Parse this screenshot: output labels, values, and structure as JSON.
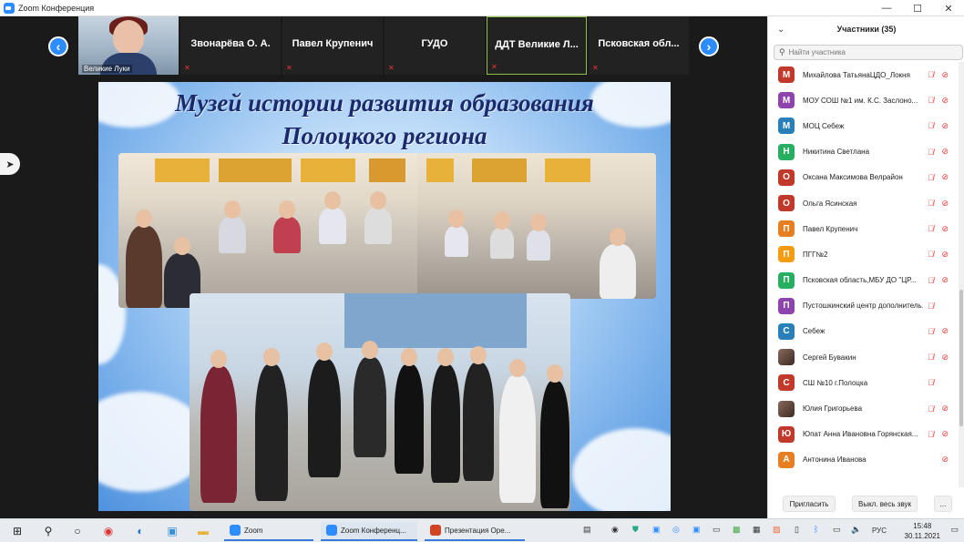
{
  "window": {
    "title": "Zoom Конференция",
    "controls": [
      "—",
      "☐",
      "✕"
    ]
  },
  "strip": {
    "tiles": [
      {
        "name": "Великие Луки",
        "type": "video"
      },
      {
        "name": "Звонарёва О. А."
      },
      {
        "name": "Павел Крупенич"
      },
      {
        "name": "ГУДО"
      },
      {
        "name": "ДДТ Великие Л...",
        "active": true
      },
      {
        "name": "Псковская обл..."
      }
    ]
  },
  "slide": {
    "title_line1": "Музей истории развития образования",
    "title_line2": "Полоцкого региона"
  },
  "panel": {
    "title": "Участники (35)",
    "search_placeholder": "Найти участника",
    "participants": [
      {
        "initial": "М",
        "name": "Михайлова ТатьянаЦДО_Локня",
        "color": "#C0392B",
        "mic_muted": true,
        "video_off": true
      },
      {
        "initial": "М",
        "name": "МОУ СОШ №1 им. К.С. Заслоно...",
        "color": "#8E44AD",
        "mic_muted": true,
        "video_off": true
      },
      {
        "initial": "М",
        "name": "МОЦ Себеж",
        "color": "#2980B9",
        "mic_muted": true,
        "video_off": true
      },
      {
        "initial": "Н",
        "name": "Никитина Светлана",
        "color": "#27AE60",
        "mic_muted": true,
        "video_off": true
      },
      {
        "initial": "О",
        "name": "Оксана Максимова Велрайон",
        "color": "#C0392B",
        "mic_muted": true,
        "video_off": true
      },
      {
        "initial": "О",
        "name": "Ольга Ясинская",
        "color": "#C0392B",
        "mic_muted": true,
        "video_off": true
      },
      {
        "initial": "П",
        "name": "Павел Крупенич",
        "color": "#E67E22",
        "mic_muted": true,
        "video_off": true
      },
      {
        "initial": "П",
        "name": "ПГГ№2",
        "color": "#F39C12",
        "mic_muted": true,
        "video_off": true
      },
      {
        "initial": "П",
        "name": "Псковская область,МБУ ДО \"ЦР...",
        "color": "#27AE60",
        "mic_muted": true,
        "video_off": true
      },
      {
        "initial": "П",
        "name": "Пустошкинский центр дополнитель...",
        "color": "#8E44AD",
        "mic_muted": true,
        "video_off": false
      },
      {
        "initial": "С",
        "name": "Себеж",
        "color": "#2980B9",
        "mic_muted": true,
        "video_off": true
      },
      {
        "initial": "",
        "name": "Сергей Бувакин",
        "color": "#5a4a40",
        "photo": true,
        "mic_muted": true,
        "video_off": true
      },
      {
        "initial": "С",
        "name": "СШ №10 г.Полоцка",
        "color": "#C0392B",
        "mic_muted": true,
        "video_off": false
      },
      {
        "initial": "",
        "name": "Юлия Григорьева",
        "color": "#5a4a40",
        "photo": true,
        "mic_muted": true,
        "video_off": true
      },
      {
        "initial": "Ю",
        "name": "Юпат Анна Ивановна Горянская...",
        "color": "#C0392B",
        "mic_muted": true,
        "video_off": true
      },
      {
        "initial": "А",
        "name": "Антонина Иванова",
        "color": "#E67E22",
        "mic_muted": false,
        "video_off": true
      }
    ],
    "footer": {
      "invite": "Пригласить",
      "mute_all": "Выкл. весь звук",
      "more": "..."
    }
  },
  "taskbar": {
    "apps": [
      {
        "label": "Zoom",
        "color": "#2D8CFF"
      },
      {
        "label": "Zoom Конференц...",
        "color": "#2D8CFF"
      },
      {
        "label": "Презентация Ope...",
        "color": "#D04423"
      }
    ],
    "lang": "РУС",
    "time": "15:48",
    "date": "30.11.2021"
  }
}
